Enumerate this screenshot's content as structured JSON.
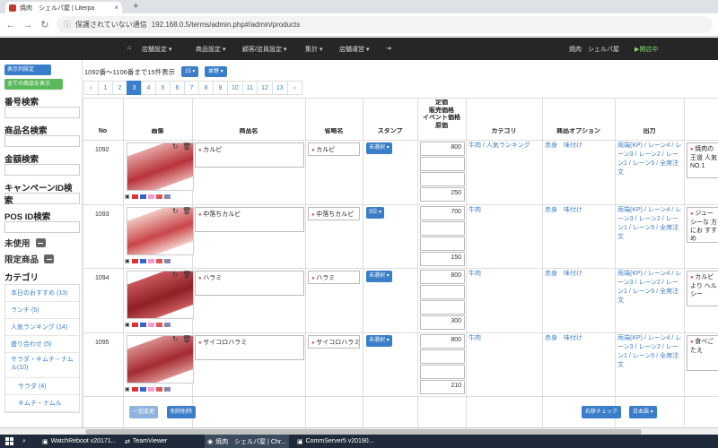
{
  "browser": {
    "tab_title": "焼肉　シェルパ屋 | Literpa",
    "tab_close": "×",
    "newtab": "+",
    "security": "保護されていない通信",
    "url": "192.168.0.5/terms/admin.php#/admin/products"
  },
  "header": {
    "menu": [
      "店舗設定 ▾",
      "商品設定 ▾",
      "顧客/店員設定 ▾",
      "集計 ▾",
      "店舗運営 ▾"
    ],
    "store_name": "焼肉　シェルパ屋",
    "status": "▶開店中"
  },
  "sidebar": {
    "btn_list_settings": "表示列設定",
    "btn_show_all": "全ての商品を表示",
    "search_labels": [
      "番号検索",
      "商品名検索",
      "金額検索",
      "キャンペーンID検索",
      "POS ID検索"
    ],
    "unused": "未使用",
    "limited": "限定商品",
    "category_heading": "カテゴリ",
    "categories": [
      "本日のおすすめ (13)",
      "ランチ (5)",
      "人気ランキング (14)",
      "盛り合わせ (5)",
      "サラダ・キムチ・ナムル(10)",
      "サラダ (4)",
      "キムチ・ナムル"
    ]
  },
  "main": {
    "summary": "1092番〜1106番まで15件表示",
    "per_page": "15 ▾",
    "sort_btn": "並替 ▾",
    "pages": [
      "«",
      "1",
      "2",
      "3",
      "4",
      "5",
      "6",
      "7",
      "8",
      "9",
      "10",
      "11",
      "12",
      "13",
      "»"
    ],
    "columns": {
      "no": "No",
      "image": "画像",
      "name": "商品名",
      "short_name": "省略名",
      "stamp": "スタンプ",
      "price": "定価\n販売価格\nイベント価格\n原価",
      "category": "カテゴリ",
      "option": "商品オプション",
      "output": "出力"
    },
    "rows": [
      {
        "no": "1092",
        "name": "カルビ",
        "short": "カルビ",
        "stamp": "未選択 ▾",
        "prices": [
          "800",
          "",
          "",
          "250"
        ],
        "category": "牛肉 / 人気ランキング",
        "options": "赤身　味付け",
        "output": "両端(KP) / レーン4 / レーン3 / レーン2 / レーン1 / レーン5 / 全席注文",
        "extra": "焼肉の王道 人気NO.1"
      },
      {
        "no": "1093",
        "name": "中落ちカルビ",
        "short": "中落ちカルビ",
        "stamp": "3位 ▾",
        "prices": [
          "700",
          "",
          "",
          "150"
        ],
        "category": "牛肉",
        "options": "赤身　味付け",
        "output": "両端(KP) / レーン4 / レーン3 / レーン2 / レーン1 / レーン5 / 全席注文",
        "extra": "ジューシーな 方にお すすめ"
      },
      {
        "no": "1094",
        "name": "ハラミ",
        "short": "ハラミ",
        "stamp": "未選択 ▾",
        "prices": [
          "800",
          "",
          "",
          "300"
        ],
        "category": "牛肉",
        "options": "赤身　味付け",
        "output": "両端(KP) / レーン4 / レーン3 / レーン2 / レーン1 / レーン5 / 全席注文",
        "extra": "カルビより ヘルシー"
      },
      {
        "no": "1095",
        "name": "サイコロハラミ",
        "short": "サイコロハラミ",
        "stamp": "未選択 ▾",
        "prices": [
          "800",
          "",
          "",
          "210"
        ],
        "category": "牛肉",
        "options": "赤身　味付け",
        "output": "両端(KP) / レーン4 / レーン3 / レーン2 / レーン1 / レーン5 / 全席注文",
        "extra": "食べごたえ"
      }
    ],
    "footer_buttons": {
      "bulk_change": "一括変更",
      "bulk_delete": "削除削除",
      "right_check": "右移チェック",
      "language": "日本語 ▾"
    }
  },
  "taskbar": {
    "items": [
      "WatchReboot v20171...",
      "TeamViewer",
      "焼肉　シェルパ屋 | Chr...",
      "CommServer5 v20190..."
    ]
  },
  "colors": {
    "accent": "#3a7dc9",
    "header_bg": "#262626",
    "open_status": "#7ed96b"
  }
}
